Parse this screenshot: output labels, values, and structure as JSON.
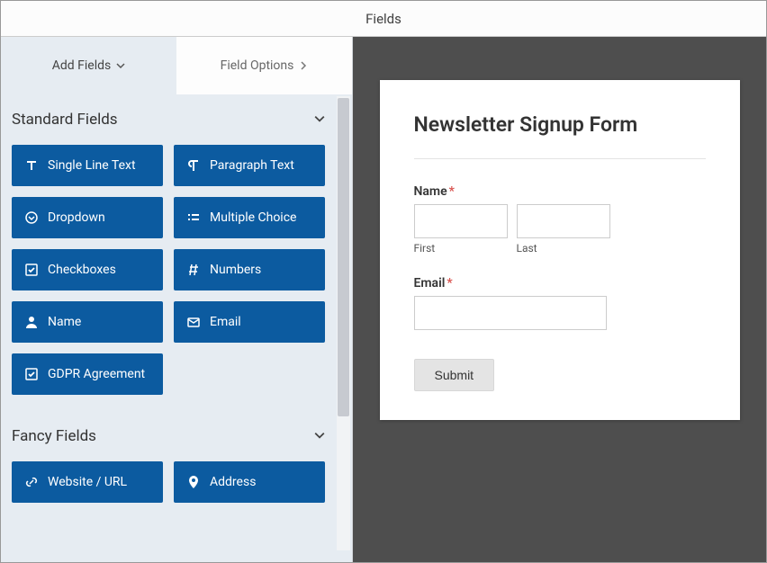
{
  "header": {
    "title": "Fields"
  },
  "tabs": {
    "add_fields": "Add Fields",
    "field_options": "Field Options"
  },
  "sections": {
    "standard": {
      "title": "Standard Fields",
      "fields": [
        {
          "label": "Single Line Text",
          "icon": "text-icon"
        },
        {
          "label": "Paragraph Text",
          "icon": "paragraph-icon"
        },
        {
          "label": "Dropdown",
          "icon": "dropdown-icon"
        },
        {
          "label": "Multiple Choice",
          "icon": "list-icon"
        },
        {
          "label": "Checkboxes",
          "icon": "check-icon"
        },
        {
          "label": "Numbers",
          "icon": "hash-icon"
        },
        {
          "label": "Name",
          "icon": "user-icon"
        },
        {
          "label": "Email",
          "icon": "envelope-icon"
        },
        {
          "label": "GDPR Agreement",
          "icon": "check-icon"
        }
      ]
    },
    "fancy": {
      "title": "Fancy Fields",
      "fields": [
        {
          "label": "Website / URL",
          "icon": "link-icon"
        },
        {
          "label": "Address",
          "icon": "pin-icon"
        }
      ]
    }
  },
  "form": {
    "title": "Newsletter Signup Form",
    "name_label": "Name",
    "first_label": "First",
    "last_label": "Last",
    "email_label": "Email",
    "submit_label": "Submit",
    "required_mark": "*"
  }
}
